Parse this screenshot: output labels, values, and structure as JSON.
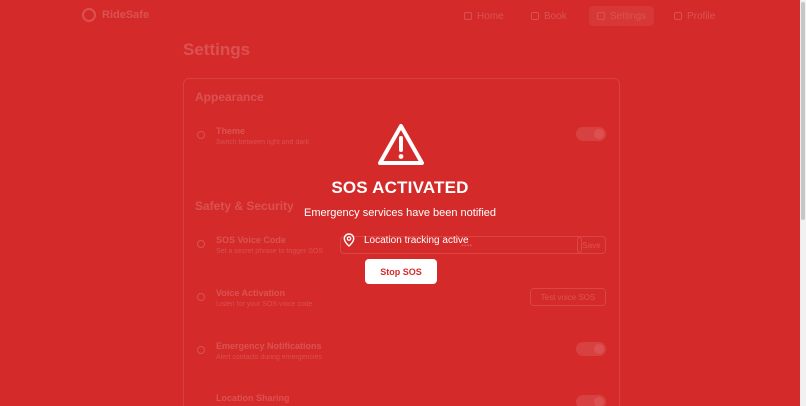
{
  "nav": {
    "brand": "RideSafe",
    "items": [
      {
        "label": "Home",
        "icon": "home-icon"
      },
      {
        "label": "Book",
        "icon": "map-pin-icon"
      },
      {
        "label": "Settings",
        "icon": "gear-icon",
        "active": true
      },
      {
        "label": "Profile",
        "icon": "user-icon"
      }
    ]
  },
  "settings": {
    "title": "Settings",
    "appearance": {
      "heading": "Appearance",
      "theme_title": "Theme",
      "theme_desc": "Switch between light and dark"
    },
    "safety": {
      "heading": "Safety & Security",
      "voice_code_title": "SOS Voice Code",
      "voice_code_desc": "Set a secret phrase to trigger SOS",
      "voice_code_value": "••••",
      "save_label": "Save",
      "voice_activation_title": "Voice Activation",
      "voice_activation_desc": "Listen for your SOS voice code",
      "test_voice_label": "Test voice SOS",
      "emergency_notifications_title": "Emergency Notifications",
      "emergency_notifications_desc": "Alert contacts during emergencies",
      "location_sharing_title": "Location Sharing"
    }
  },
  "sos": {
    "title": "SOS ACTIVATED",
    "subtitle": "Emergency services have been notified",
    "tracking": "Location tracking active",
    "stop_label": "Stop SOS"
  },
  "colors": {
    "overlay_red": "#d42a2a",
    "white": "#ffffff"
  }
}
